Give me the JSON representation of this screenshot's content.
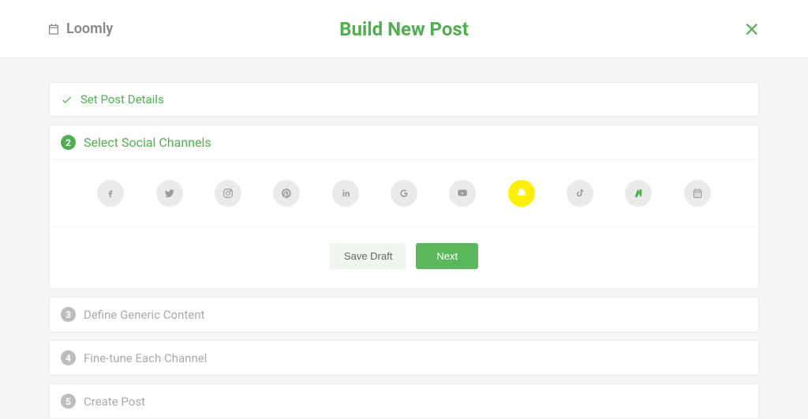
{
  "header": {
    "brand": "Loomly",
    "title": "Build New Post"
  },
  "steps": {
    "s1": {
      "label": "Set Post Details"
    },
    "s2": {
      "num": "2",
      "label": "Select Social Channels"
    },
    "s3": {
      "num": "3",
      "label": "Define Generic Content"
    },
    "s4": {
      "num": "4",
      "label": "Fine-tune Each Channel"
    },
    "s5": {
      "num": "5",
      "label": "Create Post"
    }
  },
  "channels": {
    "facebook": "facebook-icon",
    "twitter": "twitter-icon",
    "instagram": "instagram-icon",
    "pinterest": "pinterest-icon",
    "linkedin": "linkedin-icon",
    "google": "google-icon",
    "youtube": "youtube-icon",
    "snapchat": "snapchat-icon",
    "tiktok": "tiktok-icon",
    "custom": "custom-icon",
    "calendar": "calendar-icon"
  },
  "actions": {
    "draft": "Save Draft",
    "next": "Next"
  },
  "colors": {
    "accent": "#4fae4e",
    "selected_bg": "#fff000"
  }
}
